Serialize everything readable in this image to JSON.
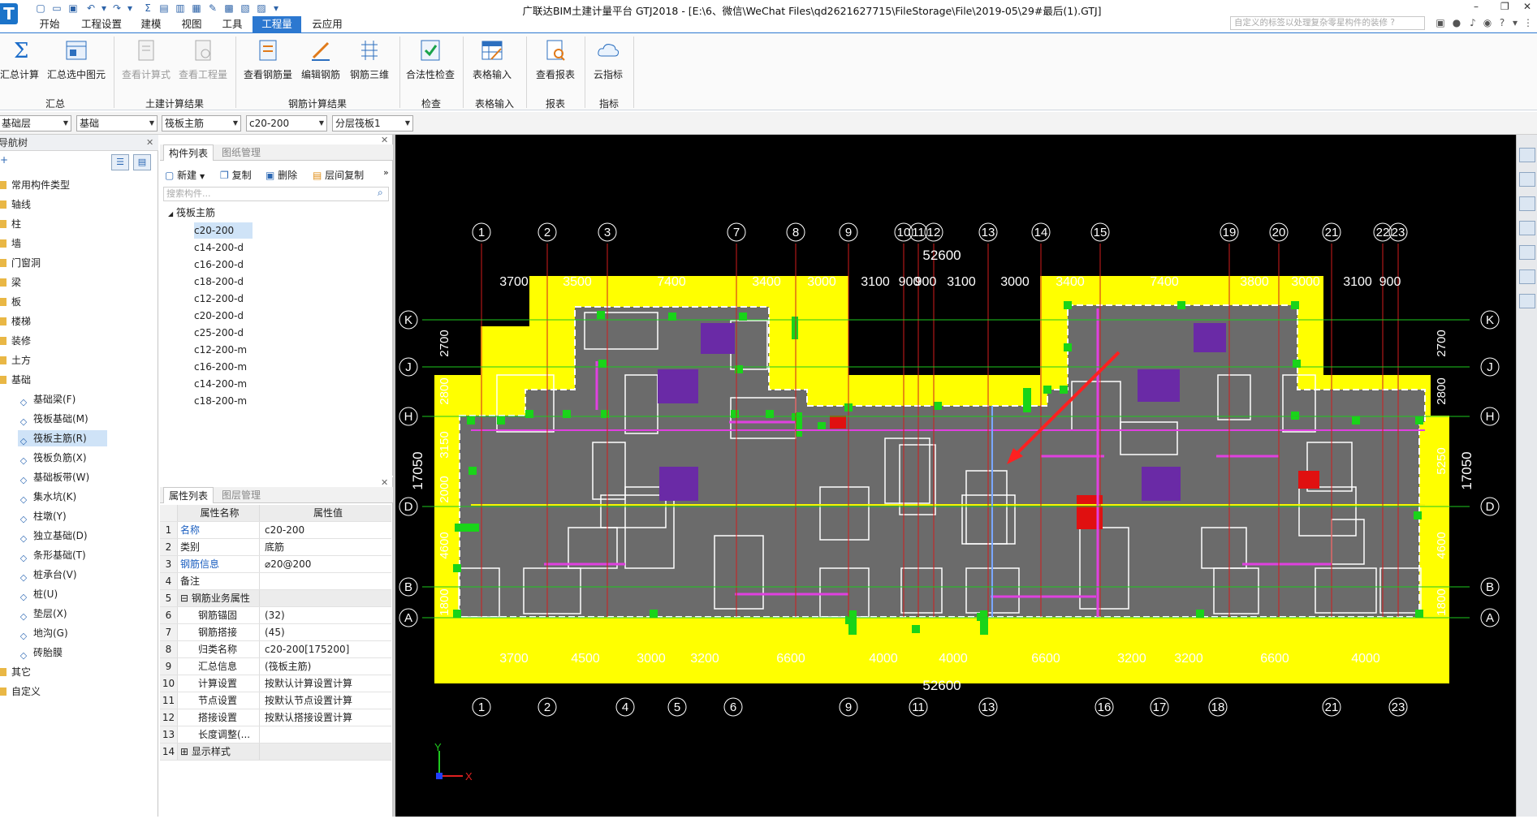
{
  "window": {
    "title": "广联达BIM土建计量平台 GTJ2018 - [E:\\6、微信\\WeChat Files\\qd2621627715\\FileStorage\\File\\2019-05\\29#最后(1).GTJ]",
    "search_placeholder": "自定义的标签以处理复杂零星构件的装修 ?"
  },
  "menu": {
    "tabs": [
      "开始",
      "工程设置",
      "建模",
      "视图",
      "工具",
      "工程量",
      "云应用"
    ],
    "active_index": 5
  },
  "ribbon": {
    "buttons": [
      {
        "label": "汇总计算",
        "icon": "sigma-icon",
        "disabled": false
      },
      {
        "label": "汇总选中图元",
        "icon": "sum-selected-icon",
        "disabled": false
      },
      {
        "label": "查看计算式",
        "icon": "formula-icon",
        "disabled": true
      },
      {
        "label": "查看工程量",
        "icon": "quantity-icon",
        "disabled": true
      },
      {
        "label": "查看钢筋量",
        "icon": "rebar-view-icon",
        "disabled": false
      },
      {
        "label": "编辑钢筋",
        "icon": "rebar-edit-icon",
        "disabled": false
      },
      {
        "label": "钢筋三维",
        "icon": "rebar-3d-icon",
        "disabled": false
      },
      {
        "label": "合法性检查",
        "icon": "check-icon",
        "disabled": false
      },
      {
        "label": "表格输入",
        "icon": "table-icon",
        "disabled": false
      },
      {
        "label": "查看报表",
        "icon": "report-icon",
        "disabled": false
      },
      {
        "label": "云指标",
        "icon": "cloud-icon",
        "disabled": false
      }
    ],
    "groups": [
      "汇总",
      "土建计算结果",
      "钢筋计算结果",
      "检查",
      "表格输入",
      "报表",
      "指标"
    ]
  },
  "combos": [
    "基础层",
    "基础",
    "筏板主筋",
    "c20-200",
    "分层筏板1"
  ],
  "nav": {
    "header": "导航树",
    "items": [
      {
        "label": "常用构件类型",
        "type": "folder"
      },
      {
        "label": "轴线",
        "type": "folder"
      },
      {
        "label": "柱",
        "type": "folder"
      },
      {
        "label": "墙",
        "type": "folder"
      },
      {
        "label": "门窗洞",
        "type": "folder"
      },
      {
        "label": "梁",
        "type": "folder"
      },
      {
        "label": "板",
        "type": "folder"
      },
      {
        "label": "楼梯",
        "type": "folder"
      },
      {
        "label": "装修",
        "type": "folder"
      },
      {
        "label": "土方",
        "type": "folder"
      },
      {
        "label": "基础",
        "type": "folder"
      },
      {
        "label": "基础梁(F)",
        "type": "sub"
      },
      {
        "label": "筏板基础(M)",
        "type": "sub"
      },
      {
        "label": "筏板主筋(R)",
        "type": "sub",
        "selected": true
      },
      {
        "label": "筏板负筋(X)",
        "type": "sub"
      },
      {
        "label": "基础板带(W)",
        "type": "sub"
      },
      {
        "label": "集水坑(K)",
        "type": "sub"
      },
      {
        "label": "柱墩(Y)",
        "type": "sub"
      },
      {
        "label": "独立基础(D)",
        "type": "sub"
      },
      {
        "label": "条形基础(T)",
        "type": "sub"
      },
      {
        "label": "桩承台(V)",
        "type": "sub"
      },
      {
        "label": "桩(U)",
        "type": "sub"
      },
      {
        "label": "垫层(X)",
        "type": "sub"
      },
      {
        "label": "地沟(G)",
        "type": "sub"
      },
      {
        "label": "砖胎膜",
        "type": "sub"
      },
      {
        "label": "其它",
        "type": "folder"
      },
      {
        "label": "自定义",
        "type": "folder"
      }
    ]
  },
  "component_panel": {
    "tabs": [
      "构件列表",
      "图纸管理"
    ],
    "tools": [
      "新建",
      "复制",
      "删除",
      "层间复制"
    ],
    "search_placeholder": "搜索构件...",
    "group": "筏板主筋",
    "items": [
      "c20-200",
      "c14-200-d",
      "c16-200-d",
      "c18-200-d",
      "c12-200-d",
      "c20-200-d",
      "c25-200-d",
      "c12-200-m",
      "c16-200-m",
      "c14-200-m",
      "c18-200-m"
    ]
  },
  "property_panel": {
    "tabs": [
      "属性列表",
      "图层管理"
    ],
    "col_name": "属性名称",
    "col_value": "属性值",
    "rows": [
      {
        "n": "1",
        "k": "名称",
        "v": "c20-200",
        "blue": true
      },
      {
        "n": "2",
        "k": "类别",
        "v": "底筋"
      },
      {
        "n": "3",
        "k": "钢筋信息",
        "v": "⌀20@200",
        "blue": true
      },
      {
        "n": "4",
        "k": "备注",
        "v": ""
      },
      {
        "n": "5",
        "k": "⊟ 钢筋业务属性",
        "v": "",
        "group": true
      },
      {
        "n": "6",
        "k": "钢筋锚固",
        "v": "(32)"
      },
      {
        "n": "7",
        "k": "钢筋搭接",
        "v": "(45)"
      },
      {
        "n": "8",
        "k": "归类名称",
        "v": "c20-200[175200]"
      },
      {
        "n": "9",
        "k": "汇总信息",
        "v": "(筏板主筋)"
      },
      {
        "n": "10",
        "k": "计算设置",
        "v": "按默认计算设置计算"
      },
      {
        "n": "11",
        "k": "节点设置",
        "v": "按默认节点设置计算"
      },
      {
        "n": "12",
        "k": "搭接设置",
        "v": "按默认搭接设置计算"
      },
      {
        "n": "13",
        "k": "长度调整(...",
        "v": ""
      },
      {
        "n": "14",
        "k": "⊞ 显示样式",
        "v": "",
        "group": true
      }
    ]
  },
  "drawing": {
    "top_axes": [
      "1",
      "2",
      "3",
      "7",
      "8",
      "9",
      "10",
      "11",
      "12",
      "13",
      "14",
      "15",
      "19",
      "20",
      "21",
      "22",
      "23"
    ],
    "top_dims": [
      "3700",
      "3500",
      "7400",
      "3400",
      "3000",
      "3100",
      "900",
      "900",
      "3100",
      "3000",
      "3400",
      "7400",
      "3800",
      "3000",
      "3100",
      "900"
    ],
    "bottom_axes": [
      "1",
      "2",
      "4",
      "5",
      "6",
      "9",
      "11",
      "13",
      "16",
      "17",
      "18",
      "21",
      "23"
    ],
    "bottom_dims": [
      "3700",
      "4500",
      "3000",
      "3200",
      "6600",
      "4000",
      "4000",
      "6600",
      "3200",
      "3200",
      "6600",
      "4000"
    ],
    "total_top": "52600",
    "total_bottom": "52600",
    "left_axes": [
      "K",
      "J",
      "H",
      "D",
      "B",
      "A"
    ],
    "left_dims": [
      "2700",
      "2800",
      "3150",
      "2000",
      "4600",
      "1800"
    ],
    "right_dims": [
      "2700",
      "2800",
      "5250",
      "4600",
      "1800"
    ],
    "total_height": "17050",
    "axis_x_label": "X",
    "axis_y_label": "Y"
  },
  "colors": {
    "accent": "#2c78d0",
    "slab_fill": "#ffff00",
    "raft": "#6b6b6b",
    "rebar_magenta": "#e040e0",
    "column_green": "#19d419",
    "pit_purple": "#6a2aa6",
    "pier_red": "#e01010",
    "axis_red": "#d21c1c",
    "axis_green": "#1ec81e"
  }
}
